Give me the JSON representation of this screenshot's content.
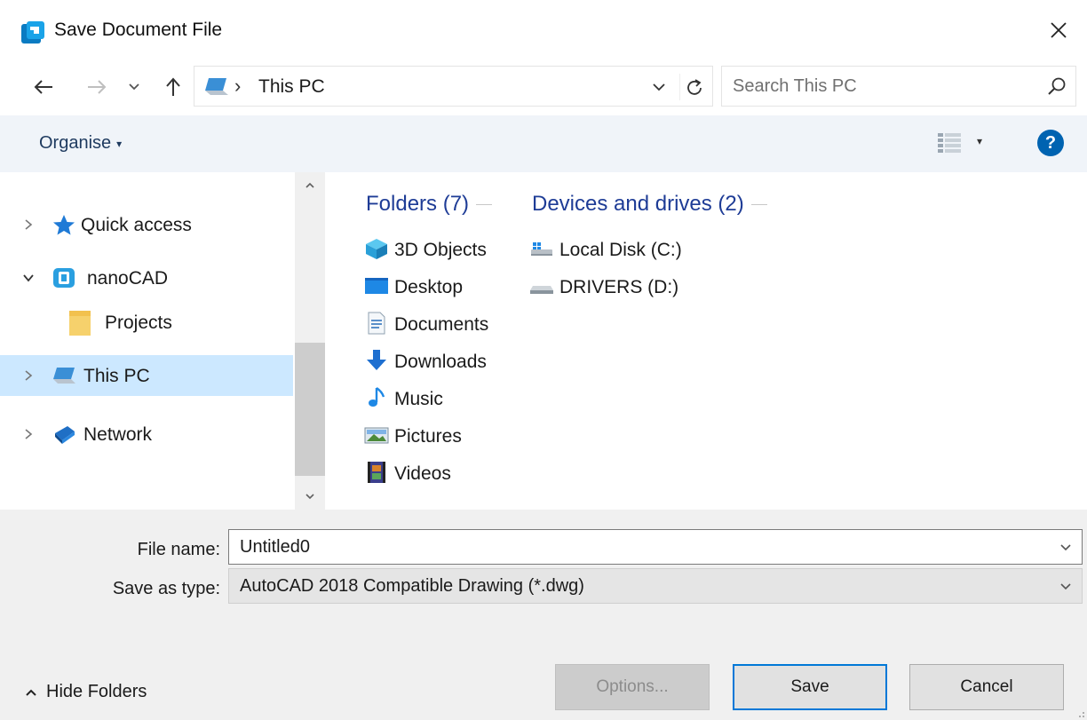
{
  "window": {
    "title": "Save Document File",
    "accent": "#0078d7"
  },
  "navigation": {
    "address_path": "This PC",
    "address_separator": "›",
    "search_placeholder": "Search This PC"
  },
  "toolbar": {
    "organise_label": "Organise",
    "help_label": "?"
  },
  "nav_tree": [
    {
      "label": "Quick access",
      "icon": "star-icon",
      "expanded": false
    },
    {
      "label": "nanoCAD",
      "icon": "nanocad-icon",
      "expanded": true
    },
    {
      "label": "Projects",
      "icon": "folder-icon"
    },
    {
      "label": "This PC",
      "icon": "computer-icon",
      "expanded": false,
      "selected": true
    },
    {
      "label": "Network",
      "icon": "network-icon",
      "expanded": false
    }
  ],
  "content": {
    "folders_heading": "Folders (7)",
    "drives_heading": "Devices and drives (2)",
    "folders": [
      {
        "label": "3D Objects",
        "icon": "3d-objects-icon"
      },
      {
        "label": "Desktop",
        "icon": "desktop-icon"
      },
      {
        "label": "Documents",
        "icon": "documents-icon"
      },
      {
        "label": "Downloads",
        "icon": "downloads-icon"
      },
      {
        "label": "Music",
        "icon": "music-icon"
      },
      {
        "label": "Pictures",
        "icon": "pictures-icon"
      },
      {
        "label": "Videos",
        "icon": "videos-icon"
      }
    ],
    "drives": [
      {
        "label": "Local Disk (C:)",
        "icon": "local-disk-icon"
      },
      {
        "label": "DRIVERS (D:)",
        "icon": "drive-icon"
      }
    ]
  },
  "form": {
    "file_name_label": "File name:",
    "file_name_value": "Untitled0",
    "save_type_label": "Save as type:",
    "save_type_value": "AutoCAD 2018 Compatible Drawing (*.dwg)"
  },
  "footer": {
    "hide_folders_label": "Hide Folders",
    "options_label": "Options...",
    "save_label": "Save",
    "cancel_label": "Cancel"
  }
}
